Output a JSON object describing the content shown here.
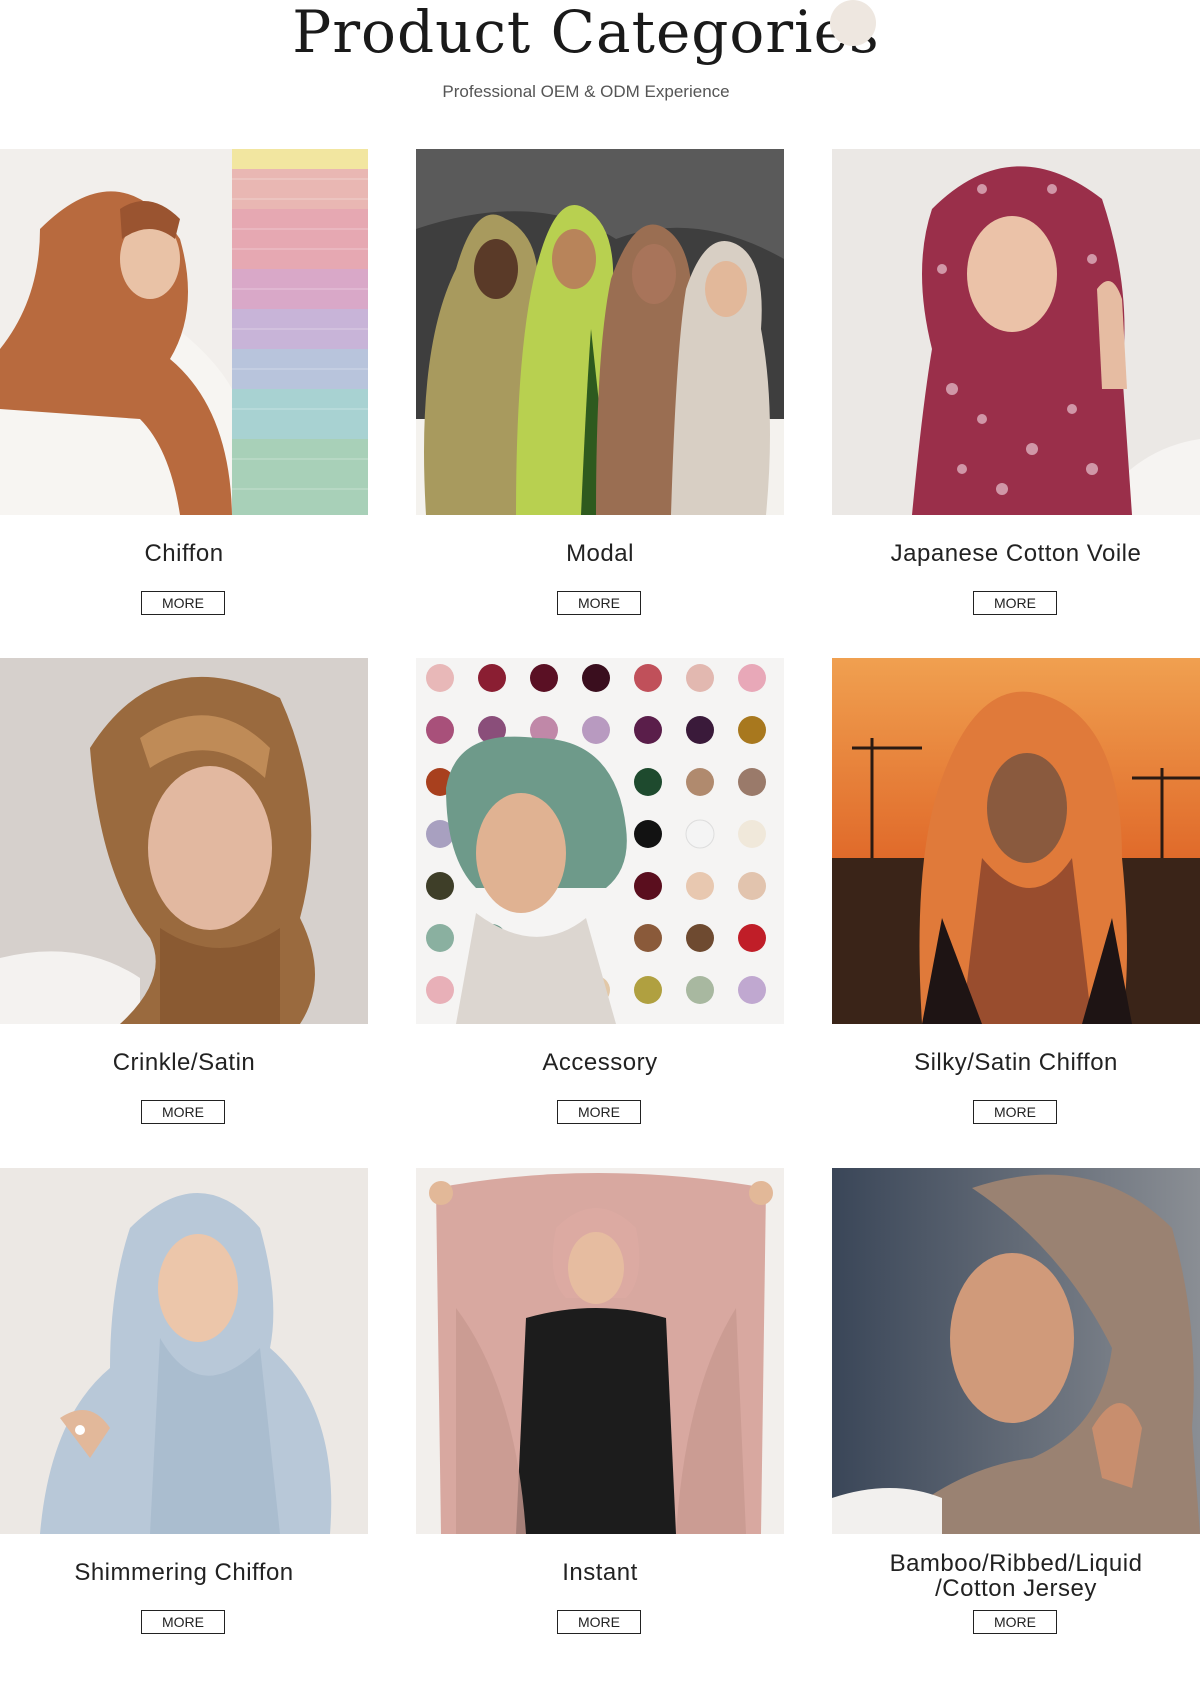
{
  "header": {
    "title": "Product Categories",
    "subtitle": "Professional OEM & ODM Experience"
  },
  "categories": [
    {
      "name": "Chiffon",
      "more_label": "MORE",
      "image": "woman-rust-chiffon-hijab-with-fabric-swatches"
    },
    {
      "name": "Modal",
      "more_label": "MORE",
      "image": "four-women-printed-modal-hijabs"
    },
    {
      "name": "Japanese Cotton Voile",
      "more_label": "MORE",
      "image": "woman-red-floral-cotton-voile-hijab"
    },
    {
      "name": "Crinkle/Satin",
      "more_label": "MORE",
      "image": "woman-bronze-satin-hijab"
    },
    {
      "name": "Accessory",
      "more_label": "MORE",
      "image": "underscarf-caps-color-grid"
    },
    {
      "name": "Silky/Satin Chiffon",
      "more_label": "MORE",
      "image": "woman-orange-printed-hijab-sunset"
    },
    {
      "name": "Shimmering Chiffon",
      "more_label": "MORE",
      "image": "woman-light-blue-shimmer-hijab"
    },
    {
      "name": "Instant",
      "more_label": "MORE",
      "image": "woman-pink-instant-hijab"
    },
    {
      "name_line1": "Bamboo/Ribbed/Liquid",
      "name_line2": "/Cotton Jersey",
      "more_label": "MORE",
      "image": "woman-taupe-jersey-hijab"
    }
  ],
  "colors": {
    "chiffon": "#b86a3e",
    "modal_bg": "#4a4a4a",
    "voile": "#9a2f4a",
    "satin": "#9a6a3e",
    "accessory_main": "#6e9a8a",
    "sunset": "#e07a3a",
    "shimmer": "#b8c8d8",
    "instant": "#d8a8a0",
    "jersey": "#9a8272"
  }
}
